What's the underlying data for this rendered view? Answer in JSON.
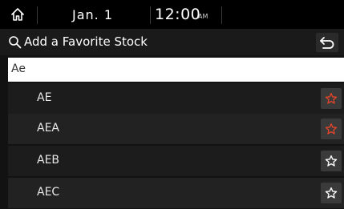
{
  "status": {
    "date": "Jan.  1",
    "time": "12:00",
    "ampm": "AM"
  },
  "header": {
    "title": "Add a Favorite Stock"
  },
  "search": {
    "value": "Ae"
  },
  "stocks": [
    {
      "symbol": "AE",
      "favorite": true
    },
    {
      "symbol": "AEA",
      "favorite": true
    },
    {
      "symbol": "AEB",
      "favorite": false
    },
    {
      "symbol": "AEC",
      "favorite": false
    }
  ],
  "colors": {
    "favorite_star": "#e0452b",
    "default_star": "#ffffff"
  }
}
